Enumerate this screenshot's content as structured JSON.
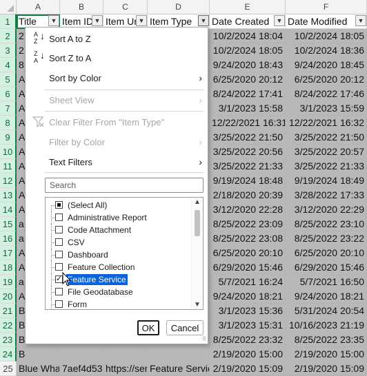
{
  "columns": [
    "A",
    "B",
    "C",
    "D",
    "E",
    "F"
  ],
  "headers": [
    "Title",
    "Item ID",
    "Item Url",
    "Item Type",
    "Date Created",
    "Date Modified"
  ],
  "row_numbers": [
    "1",
    "2",
    "3",
    "4",
    "5",
    "6",
    "7",
    "8",
    "9",
    "10",
    "11",
    "12",
    "13",
    "14",
    "15",
    "16",
    "17",
    "18",
    "19",
    "20",
    "21",
    "22",
    "23",
    "24",
    "25"
  ],
  "col_a_fragments": [
    "2",
    "2",
    "8",
    "A",
    "A",
    "A",
    "A",
    "A",
    "A",
    "A",
    "A",
    "A",
    "A",
    "a",
    "a",
    "A",
    "A",
    "a",
    "A",
    "B",
    "B",
    "B",
    "B",
    "Blue Whal"
  ],
  "date_created": [
    "10/2/2024 18:04",
    "10/2/2024 18:05",
    "9/24/2020 18:43",
    "6/25/2020 20:12",
    "8/24/2022 17:41",
    "3/1/2023 15:58",
    "12/22/2021 16:31",
    "3/25/2022 21:50",
    "3/25/2022 20:56",
    "3/25/2022 21:33",
    "9/19/2024 18:48",
    "2/18/2020 20:39",
    "3/12/2020 22:28",
    "8/25/2022 23:09",
    "8/25/2022 23:08",
    "6/25/2020 20:10",
    "6/29/2020 15:46",
    "5/7/2021 16:24",
    "9/24/2020 18:21",
    "3/1/2023 15:36",
    "3/1/2023 15:31",
    "8/25/2022 23:32",
    "2/19/2020 15:00",
    "2/19/2020 15:09"
  ],
  "date_modified": [
    "10/2/2024 18:05",
    "10/2/2024 18:36",
    "9/24/2020 18:45",
    "6/25/2020 20:12",
    "8/24/2022 17:46",
    "3/1/2023 15:59",
    "12/22/2021 16:32",
    "3/25/2022 21:50",
    "3/25/2022 20:57",
    "3/25/2022 21:33",
    "9/19/2024 18:49",
    "3/28/2022 17:33",
    "3/12/2020 22:29",
    "8/25/2022 23:10",
    "8/25/2022 23:22",
    "6/25/2020 20:10",
    "6/29/2020 15:46",
    "5/7/2021 16:50",
    "9/24/2020 18:21",
    "5/31/2024 20:54",
    "10/16/2023 21:19",
    "8/25/2022 23:35",
    "2/19/2020 15:00",
    "2/19/2020 15:09"
  ],
  "last_row_partial": {
    "b": "7aef4d531",
    "c": "https://ser",
    "d": "Feature Servic"
  },
  "menu": {
    "sort_az": "Sort A to Z",
    "sort_za": "Sort Z to A",
    "sort_by_color": "Sort by Color",
    "sheet_view": "Sheet View",
    "clear_filter": "Clear Filter From \"Item Type\"",
    "filter_by_color": "Filter by Color",
    "text_filters": "Text Filters",
    "search_placeholder": "Search",
    "ok": "OK",
    "cancel": "Cancel"
  },
  "filter_items": [
    {
      "label": "(Select All)",
      "state": "mixed"
    },
    {
      "label": "Administrative Report",
      "state": "unchecked"
    },
    {
      "label": "Code Attachment",
      "state": "unchecked"
    },
    {
      "label": "CSV",
      "state": "unchecked"
    },
    {
      "label": "Dashboard",
      "state": "unchecked"
    },
    {
      "label": "Feature Collection",
      "state": "unchecked"
    },
    {
      "label": "Feature Service",
      "state": "checked"
    },
    {
      "label": "File Geodatabase",
      "state": "unchecked"
    },
    {
      "label": "Form",
      "state": "unchecked"
    }
  ],
  "colors": {
    "excel_green": "#107c41",
    "highlight": "#0a64d8",
    "dim_cell": "#b8b8b8"
  }
}
